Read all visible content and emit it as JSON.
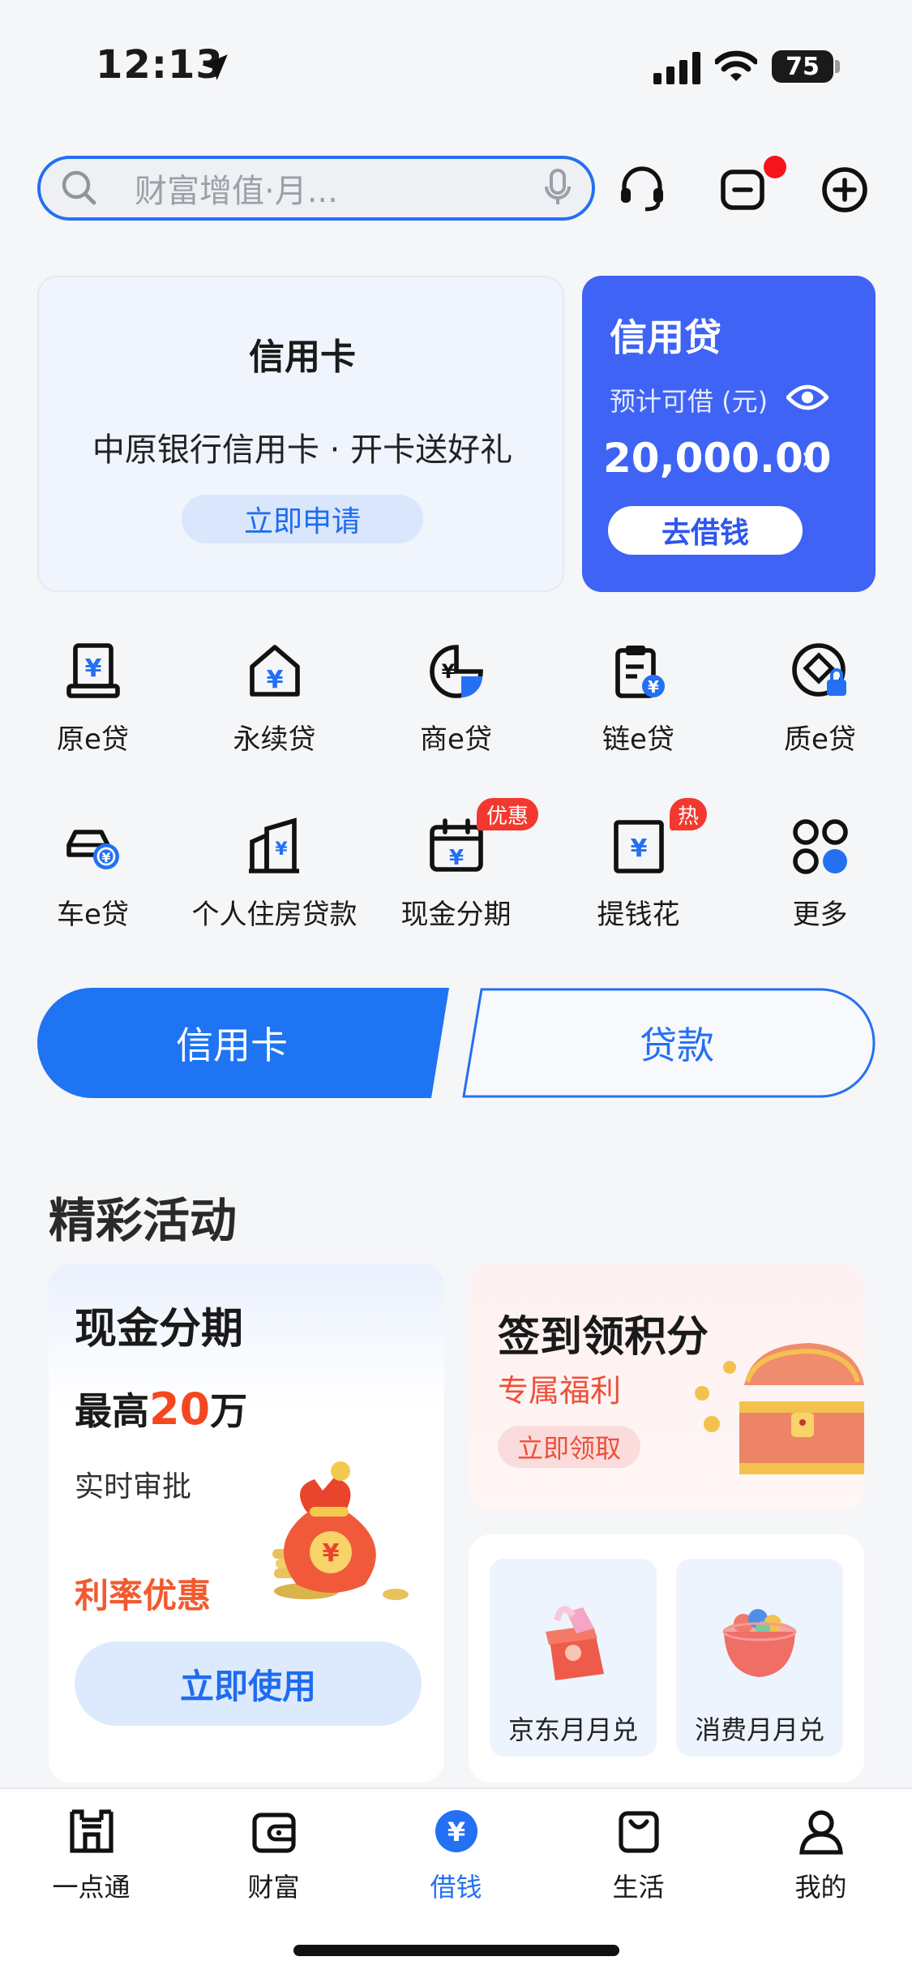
{
  "status_bar": {
    "time": "12:13",
    "battery": "75"
  },
  "search": {
    "placeholder": "财富增值·月..."
  },
  "credit_card_promo": {
    "title": "信用卡",
    "subtitle": "中原银行信用卡 · 开卡送好礼",
    "button": "立即申请"
  },
  "credit_loan": {
    "title": "信用贷",
    "subtitle": "预计可借 (元)",
    "amount": "20,000.00",
    "button": "去借钱"
  },
  "products": [
    {
      "label": "原e贷",
      "icon": "register-loan-icon"
    },
    {
      "label": "永续贷",
      "icon": "house-yen-icon"
    },
    {
      "label": "商e贷",
      "icon": "pie-yen-icon"
    },
    {
      "label": "链e贷",
      "icon": "clipboard-yen-icon"
    },
    {
      "label": "质e贷",
      "icon": "diamond-lock-icon"
    },
    {
      "label": "车e贷",
      "icon": "car-yen-icon"
    },
    {
      "label": "个人住房贷款",
      "icon": "building-yen-icon"
    },
    {
      "label": "现金分期",
      "icon": "calendar-yen-icon",
      "badge": "优惠"
    },
    {
      "label": "提钱花",
      "icon": "yen-card-icon",
      "badge": "热"
    },
    {
      "label": "更多",
      "icon": "more-dots-icon"
    }
  ],
  "tabs": {
    "credit_card": "信用卡",
    "loan": "贷款"
  },
  "activities": {
    "title": "精彩活动",
    "cash_installment": {
      "title": "现金分期",
      "max_prefix": "最高",
      "max_value": "20",
      "max_suffix": "万",
      "subtitle": "实时审批",
      "rate": "利率优惠",
      "button": "立即使用"
    },
    "sign_in": {
      "title": "签到领积分",
      "subtitle": "专属福利",
      "button": "立即领取"
    },
    "monthly": [
      {
        "label": "京东月月兑",
        "icon": "gift-box-icon"
      },
      {
        "label": "消费月月兑",
        "icon": "candy-bowl-icon"
      }
    ]
  },
  "bottom_nav": [
    {
      "label": "一点通",
      "icon": "home-castle-icon"
    },
    {
      "label": "财富",
      "icon": "wallet-icon"
    },
    {
      "label": "借钱",
      "icon": "yen-circle-icon",
      "active": true
    },
    {
      "label": "生活",
      "icon": "shopping-bag-icon"
    },
    {
      "label": "我的",
      "icon": "person-icon"
    }
  ],
  "colors": {
    "primary": "#2470f3",
    "loan_card": "#3e63f5",
    "badge": "#f2382f",
    "highlight": "#f5461f"
  }
}
